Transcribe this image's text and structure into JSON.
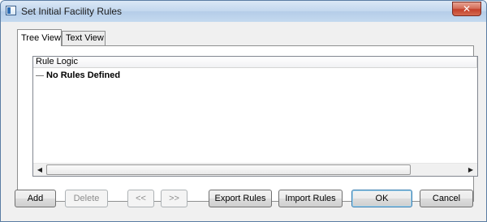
{
  "window": {
    "title": "Set Initial Facility Rules",
    "close_glyph": "✕"
  },
  "tabs": [
    {
      "label": "Tree View",
      "active": true
    },
    {
      "label": "Text View",
      "active": false
    }
  ],
  "tree": {
    "column_header": "Rule Logic",
    "items": [
      {
        "label": "No Rules Defined"
      }
    ]
  },
  "scrollbar": {
    "left_glyph": "◀",
    "right_glyph": "▶"
  },
  "buttons": {
    "add": "Add",
    "delete": "Delete",
    "prev": "<<",
    "next": ">>",
    "export_rules": "Export Rules",
    "import_rules": "Import Rules",
    "ok": "OK",
    "cancel": "Cancel"
  }
}
